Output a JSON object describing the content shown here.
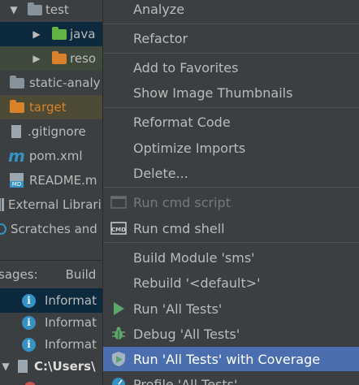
{
  "project_tree": {
    "rows": [
      {
        "label": "test"
      },
      {
        "label": "java"
      },
      {
        "label": "reso"
      },
      {
        "label": "static-analy"
      },
      {
        "label": "target"
      },
      {
        "label": ".gitignore"
      },
      {
        "label": "pom.xml"
      },
      {
        "label": "README.m"
      },
      {
        "label": "External Librari"
      },
      {
        "label": "Scratches and"
      }
    ]
  },
  "messages": {
    "label": "sages:",
    "build_tab": "Build",
    "items": [
      "Informat",
      "Informat",
      "Informat"
    ],
    "path_row": "C:\\Users\\"
  },
  "context_menu": {
    "items": [
      {
        "label": "Analyze"
      },
      {
        "label": "Refactor"
      },
      {
        "label": "Add to Favorites"
      },
      {
        "label": "Show Image Thumbnails"
      },
      {
        "label": "Reformat Code"
      },
      {
        "label": "Optimize Imports"
      },
      {
        "label": "Delete..."
      },
      {
        "label": "Run cmd script"
      },
      {
        "label": "Run cmd shell"
      },
      {
        "label": "Build Module 'sms'"
      },
      {
        "label": "Rebuild '<default>'"
      },
      {
        "label": "Run 'All Tests'"
      },
      {
        "label": "Debug 'All Tests'"
      },
      {
        "label": "Run 'All Tests' with Coverage"
      },
      {
        "label": "Profile 'All Tests'"
      }
    ]
  },
  "colors": {
    "background": "#3c3f41",
    "selection": "#4b6eaf",
    "text": "#bbbbbb",
    "disabled_text": "#787878",
    "run_green": "#59a869"
  }
}
